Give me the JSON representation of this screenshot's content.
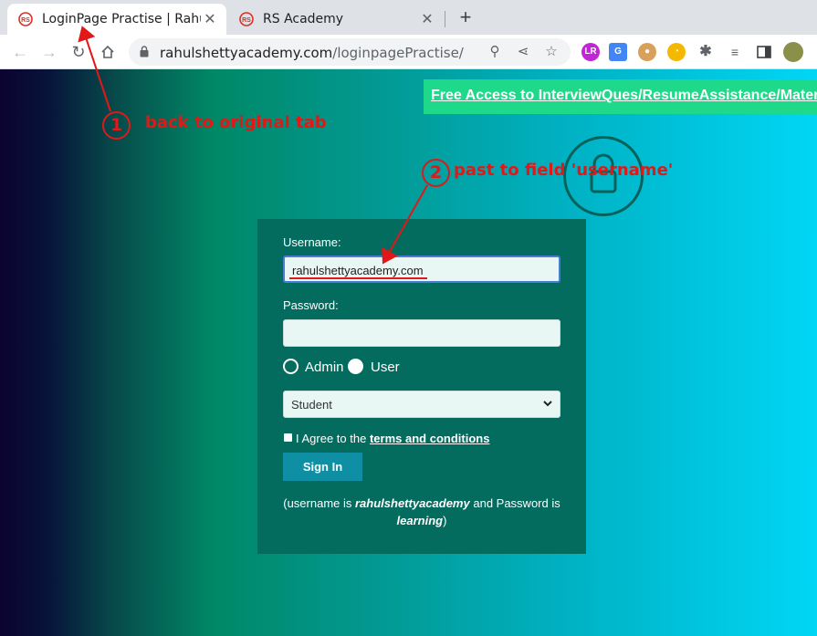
{
  "browser": {
    "tabs": [
      {
        "title": "LoginPage Practise | Rahul",
        "active": true
      },
      {
        "title": "RS Academy",
        "active": false
      }
    ],
    "new_tab": "+",
    "url_host": "rahulshettyacademy.com",
    "url_path": "/loginpagePractise/"
  },
  "page": {
    "banner_link": "Free Access to InterviewQues/ResumeAssistance/Material",
    "form": {
      "username_label": "Username:",
      "username_value": "rahulshettyacademy.com",
      "password_label": "Password:",
      "password_value": "",
      "radio_admin": "Admin",
      "radio_user": "User",
      "select_value": "Student",
      "terms_prefix": "I Agree to the",
      "terms_link": "terms and conditions",
      "signin_label": "Sign In",
      "hint_1": "(username is",
      "hint_user": "rahulshettyacademy",
      "hint_2": "and Password is",
      "hint_pass": "learning",
      "hint_3": ")"
    }
  },
  "annotations": {
    "step1_number": "1",
    "step1_text": "back to original tab",
    "step2_number": "2",
    "step2_text": "past to field 'username'"
  },
  "colors": {
    "annotation": "#e01818",
    "banner": "#1fd98a",
    "form_bg": "#046b5f",
    "signin": "#0f8fa3"
  }
}
